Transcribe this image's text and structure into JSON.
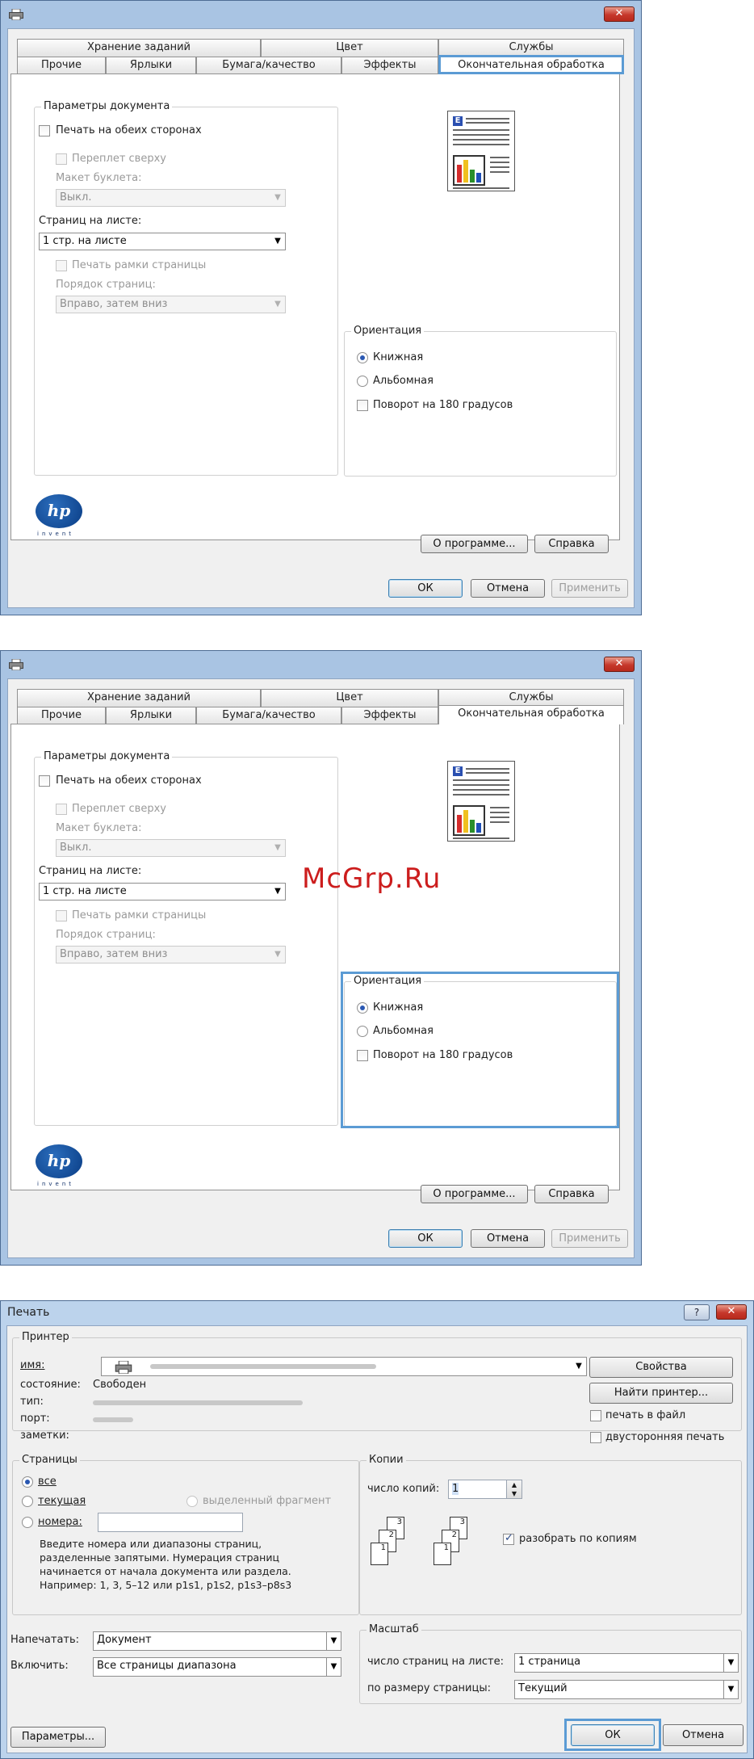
{
  "dialog": {
    "close_label": "✕",
    "tabs_back": [
      "Хранение заданий",
      "Цвет",
      "Службы"
    ],
    "tabs_front": [
      "Прочие",
      "Ярлыки",
      "Бумага/качество",
      "Эффекты",
      "Окончательная обработка"
    ],
    "doc_options": {
      "title": "Параметры документа",
      "duplex": "Печать на обеих сторонах",
      "flip_up": "Переплет сверху",
      "booklet_label": "Макет буклета:",
      "booklet_value": "Выкл.",
      "pages_per_sheet_label": "Страниц на листе:",
      "pages_per_sheet_value": "1 стр. на листе",
      "borders": "Печать рамки страницы",
      "page_order_label": "Порядок страниц:",
      "page_order_value": "Вправо, затем вниз"
    },
    "orientation": {
      "title": "Ориентация",
      "portrait": "Книжная",
      "landscape": "Альбомная",
      "rotate": "Поворот на 180 градусов"
    },
    "logo_text": "hp",
    "logo_tagline": "invent",
    "about_btn": "О программе...",
    "help_btn": "Справка",
    "ok_btn": "ОК",
    "cancel_btn": "Отмена",
    "apply_btn": "Применить"
  },
  "watermark": "McGrp.Ru",
  "print": {
    "title": "Печать",
    "help_icon_label": "?",
    "close_label": "✕",
    "printer_group": "Принтер",
    "name_label": "имя:",
    "status_label": "состояние:",
    "status_value": "Свободен",
    "type_label": "тип:",
    "port_label": "порт:",
    "notes_label": "заметки:",
    "properties_btn": "Свойства",
    "find_printer_btn": "Найти принтер...",
    "print_to_file": "печать в файл",
    "duplex": "двусторонняя печать",
    "pages_group": "Страницы",
    "all": "все",
    "current": "текущая",
    "selection": "выделенный фрагмент",
    "numbers": "номера:",
    "hint": [
      "Введите номера или диапазоны страниц,",
      "разделенные запятыми. Нумерация страниц",
      "начинается от начала документа или раздела.",
      "Например: 1, 3, 5–12 или p1s1, p1s2, p1s3–p8s3"
    ],
    "copies_group": "Копии",
    "copies_label": "число копий:",
    "copies_value": "1",
    "collate": "разобрать по копиям",
    "print_what_label": "Напечатать:",
    "print_what_value": "Документ",
    "include_label": "Включить:",
    "include_value": "Все страницы диапазона",
    "zoom_group": "Масштаб",
    "pps_label": "число страниц на листе:",
    "pps_value": "1 страница",
    "scale_label": "по размеру страницы:",
    "scale_value": "Текущий",
    "options_btn": "Параметры...",
    "ok_btn": "ОК",
    "cancel_btn": "Отмена"
  }
}
